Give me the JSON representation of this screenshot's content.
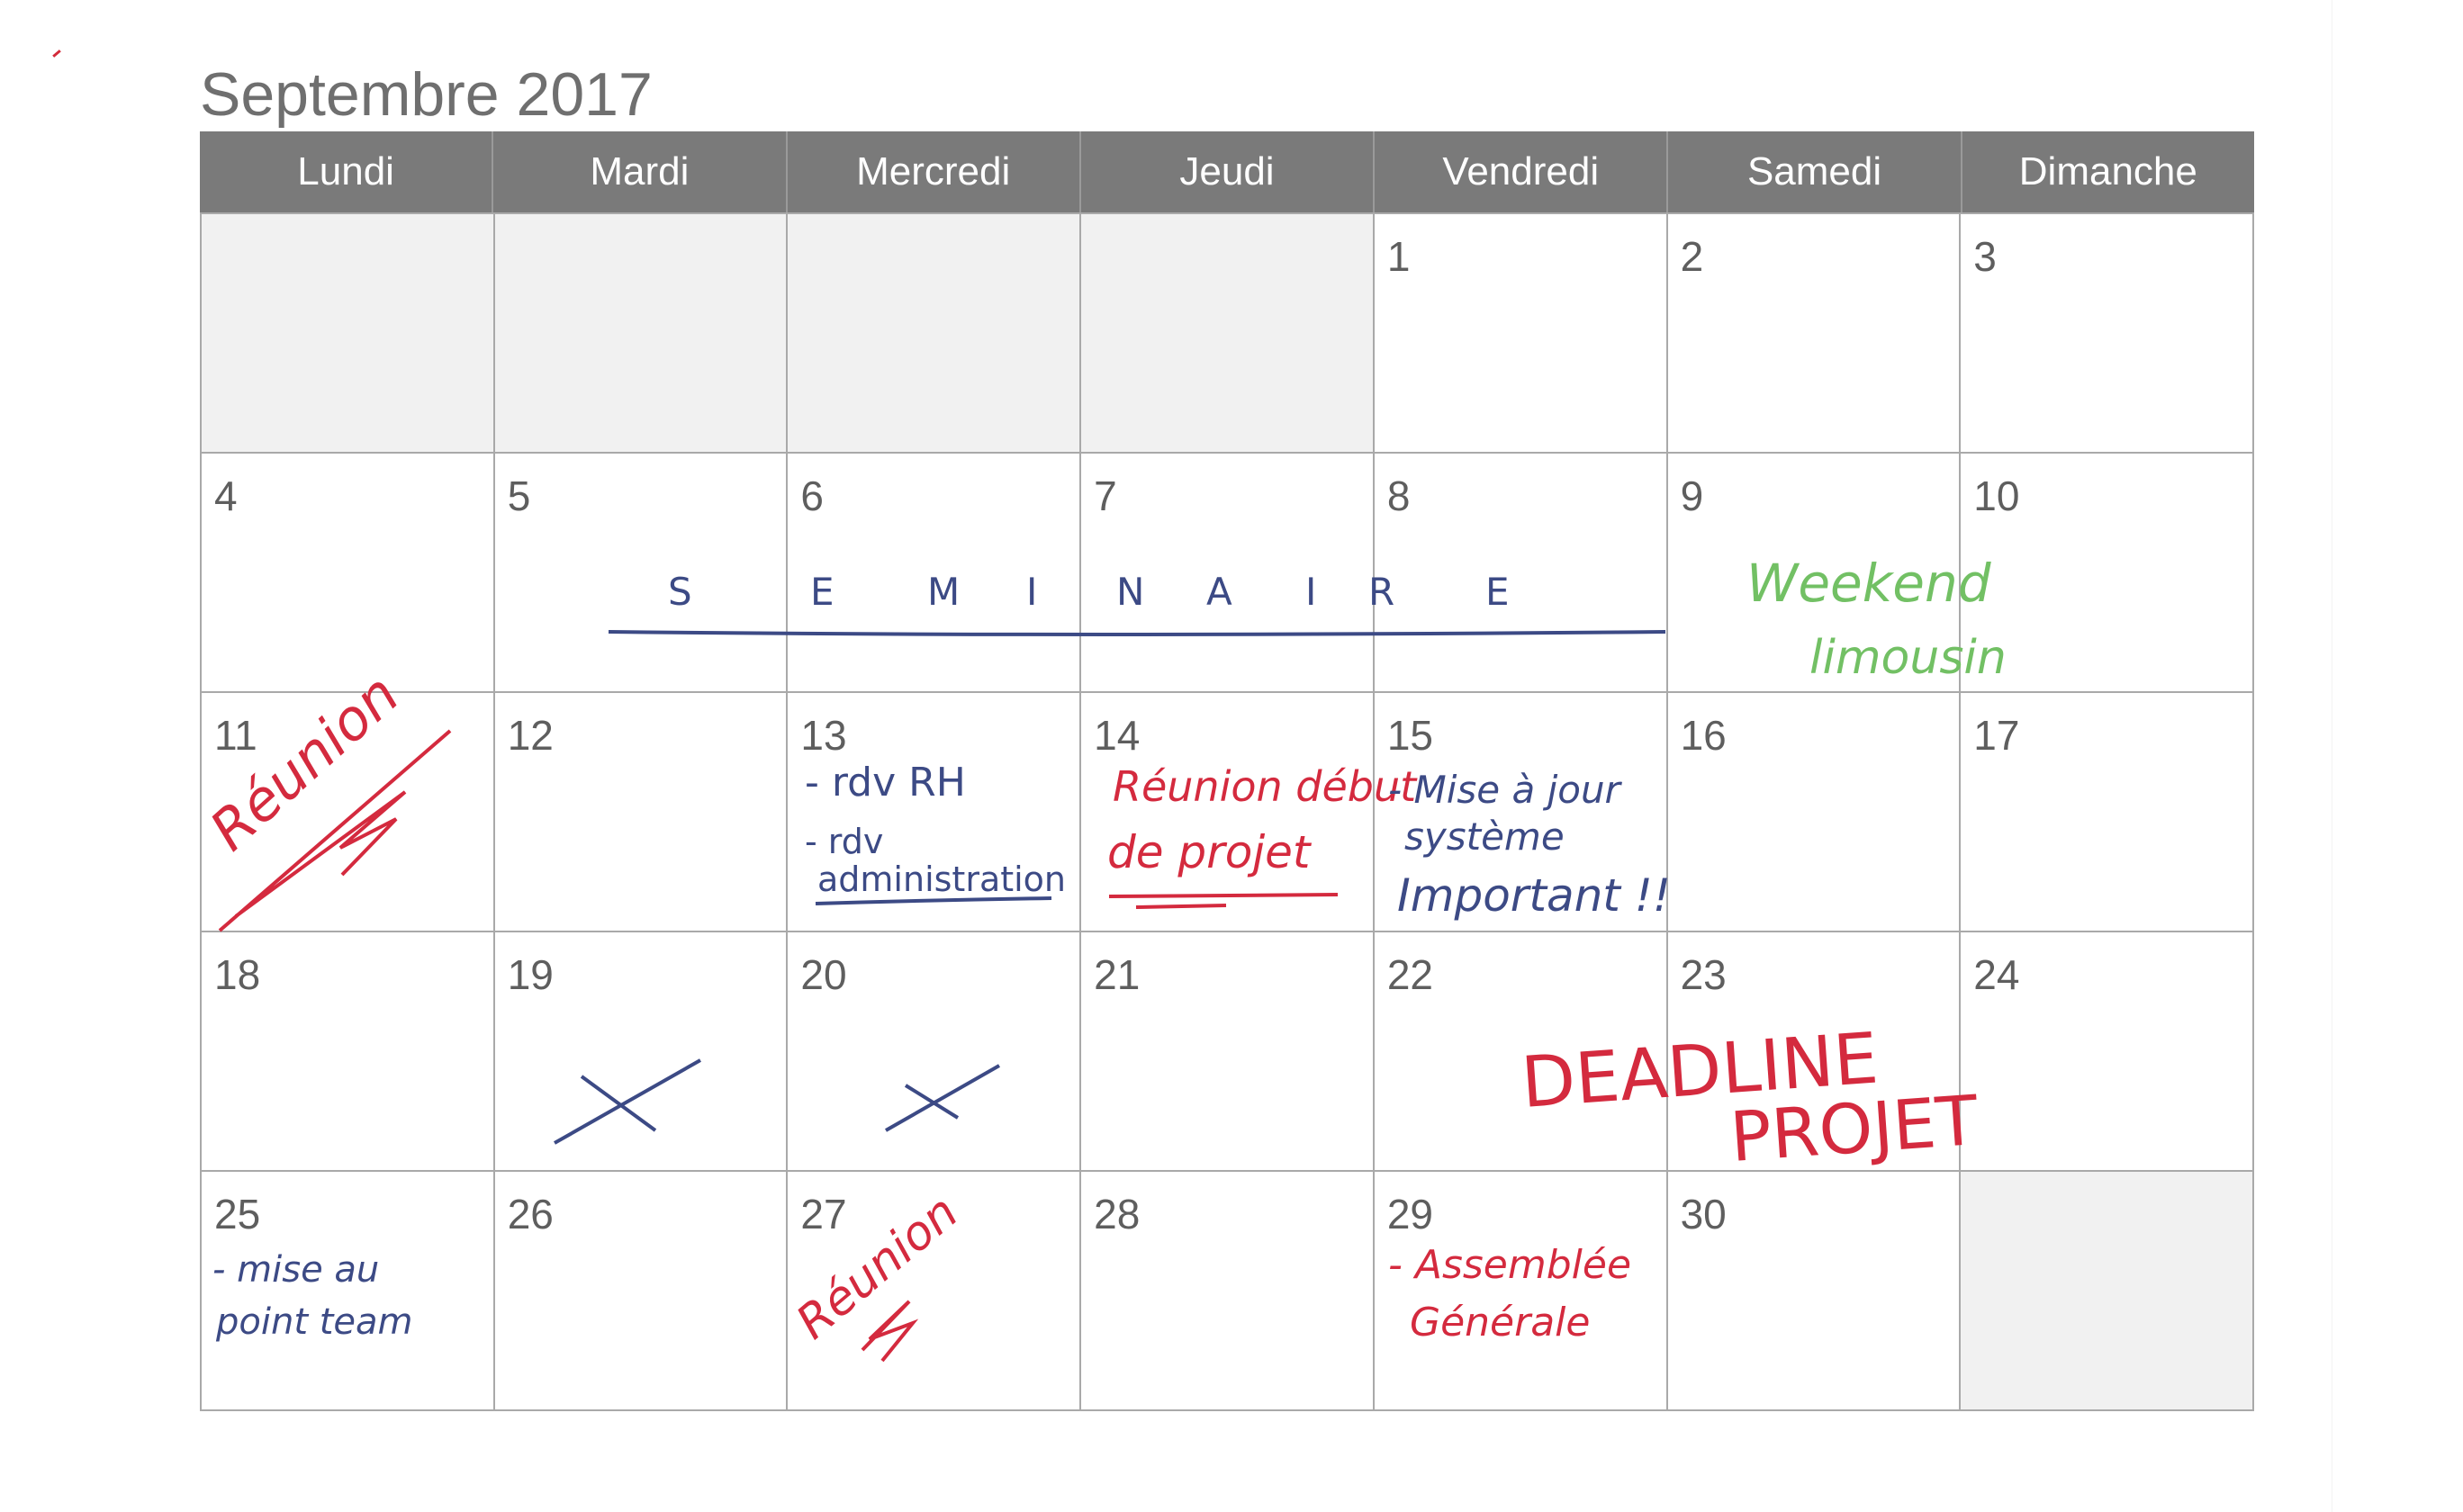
{
  "calendar": {
    "month_title": "Septembre 2017",
    "weekdays": [
      "Lundi",
      "Mardi",
      "Mercredi",
      "Jeudi",
      "Vendredi",
      "Samedi",
      "Dimanche"
    ],
    "weeks": [
      [
        "",
        "",
        "",
        "",
        "1",
        "2",
        "3"
      ],
      [
        "4",
        "5",
        "6",
        "7",
        "8",
        "9",
        "10"
      ],
      [
        "11",
        "12",
        "13",
        "14",
        "15",
        "16",
        "17"
      ],
      [
        "18",
        "19",
        "20",
        "21",
        "22",
        "23",
        "24"
      ],
      [
        "25",
        "26",
        "27",
        "28",
        "29",
        "30",
        ""
      ]
    ]
  },
  "notes": {
    "seminaire_letters": [
      "S",
      "E",
      "M",
      "I",
      "N",
      "A",
      "I",
      "R",
      "E"
    ],
    "weekend_line1": "Weekend",
    "weekend_line2": "limousin",
    "reunion_11": "Réunion",
    "rdv_rh": "- rdv RH",
    "rdv_admin_line1": "- rdv",
    "rdv_admin_line2": "administration",
    "reunion_debut_line1": "Réunion début",
    "reunion_debut_line2": "de projet",
    "mise_a_jour_line1": "- Mise à jour",
    "mise_a_jour_line2": "système",
    "mise_a_jour_line3": "Important !!",
    "deadline_line1": "DEADLINE",
    "deadline_line2": "PROJET",
    "mise_au_point_line1": "- mise au",
    "mise_au_point_line2": "point team",
    "reunion_27": "Réunion",
    "assemblee_line1": "- Assemblée",
    "assemblee_line2": "Générale"
  },
  "colors": {
    "header_bg": "#7a7a7a",
    "empty_cell": "#f1f1f1",
    "ink_blue": "#3c4a85",
    "ink_red": "#d42a3e",
    "ink_green": "#72c064"
  }
}
